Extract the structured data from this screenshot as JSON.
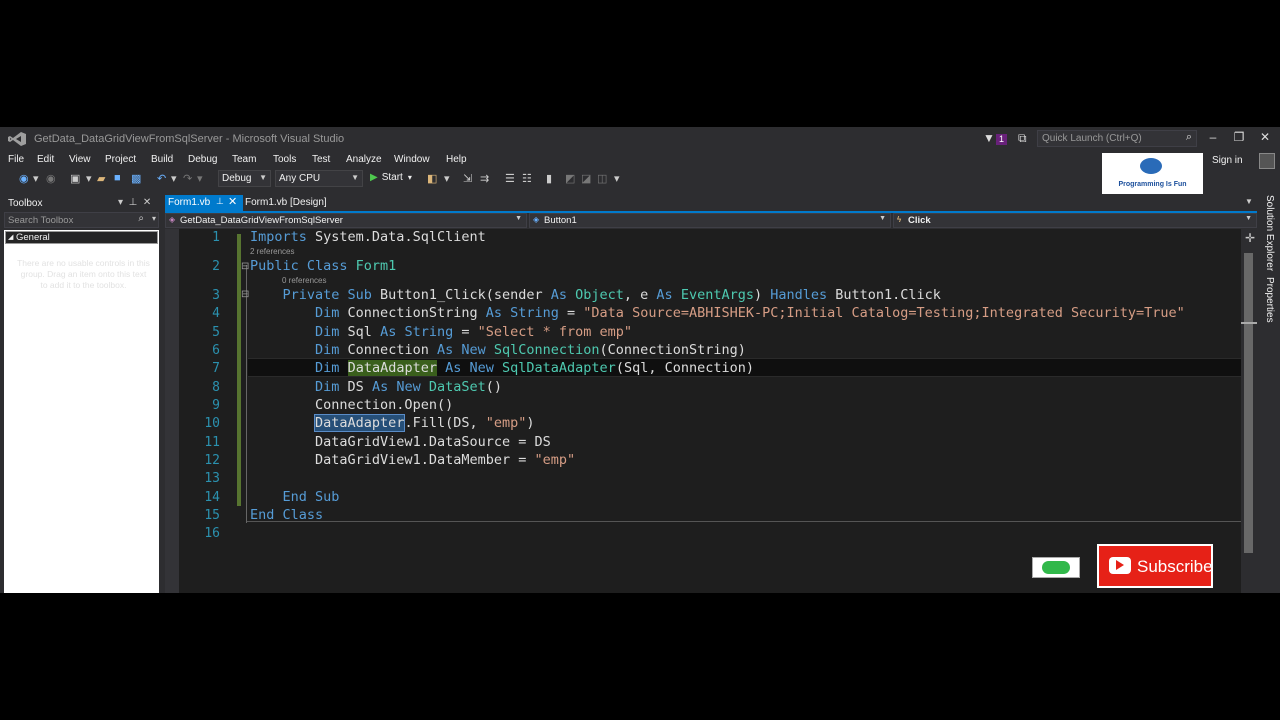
{
  "window": {
    "title": "GetData_DataGridViewFromSqlServer - Microsoft Visual Studio",
    "notification_count": "1",
    "quick_launch_placeholder": "Quick Launch (Ctrl+Q)",
    "sign_in": "Sign in"
  },
  "menu": [
    "File",
    "Edit",
    "View",
    "Project",
    "Build",
    "Debug",
    "Team",
    "Tools",
    "Test",
    "Analyze",
    "Window",
    "Help"
  ],
  "toolbar": {
    "config": "Debug",
    "platform": "Any CPU",
    "start": "Start"
  },
  "logo": {
    "text": "Programming Is Fun"
  },
  "toolbox": {
    "title": "Toolbox",
    "search_placeholder": "Search Toolbox",
    "group": "General",
    "empty_message": "There are no usable controls in this group. Drag an item onto this text to add it to the toolbox."
  },
  "tabs": {
    "active": "Form1.vb",
    "design": "Form1.vb [Design]"
  },
  "navbar": {
    "project": "GetData_DataGridViewFromSqlServer",
    "object": "Button1",
    "event": "Click"
  },
  "side_tabs": [
    "Solution Explorer",
    "Properties"
  ],
  "editor": {
    "references": [
      "2 references",
      "0 references"
    ],
    "line_numbers": [
      "1",
      "2",
      "3",
      "4",
      "5",
      "6",
      "7",
      "8",
      "9",
      "10",
      "11",
      "12",
      "13",
      "14",
      "15",
      "16"
    ],
    "code": {
      "l1": {
        "k": "Imports",
        "t": " System.Data.SqlClient"
      },
      "l2": {
        "k": "Public Class",
        "t": " Form1"
      },
      "l3": {
        "k1": "Private Sub",
        "t1": " Button1_Click(sender ",
        "k2": "As",
        "ty1": " Object",
        "t2": ", e ",
        "k3": "As",
        "ty2": " EventArgs",
        "t3": ") ",
        "k4": "Handles",
        "t4": " Button1.Click"
      },
      "l4": {
        "k1": "Dim",
        "t1": " ConnectionString ",
        "k2": "As",
        "k3": " String",
        "t2": " = ",
        "s": "\"Data Source=ABHISHEK-PC;Initial Catalog=Testing;Integrated Security=True\""
      },
      "l5": {
        "k1": "Dim",
        "t1": " Sql ",
        "k2": "As",
        "k3": " String",
        "t2": " = ",
        "s": "\"Select * from emp\""
      },
      "l6": {
        "k1": "Dim",
        "t1": " Connection ",
        "k2": "As New",
        "ty": " SqlConnection",
        "t2": "(ConnectionString)"
      },
      "l7": {
        "k1": "Dim",
        "hl": "DataAdapter",
        "k2": "As New",
        "ty": " SqlDataAdapter",
        "t2": "(Sql, Connection)"
      },
      "l8": {
        "k1": "Dim",
        "t1": " DS ",
        "k2": "As New",
        "ty": " DataSet",
        "t2": "()"
      },
      "l9": {
        "t": "Connection.Open()"
      },
      "l10": {
        "hl": "DataAdapter",
        "t1": ".Fill(DS, ",
        "s": "\"emp\"",
        "t2": ")"
      },
      "l11": {
        "t": "DataGridView1.DataSource = DS"
      },
      "l12": {
        "t1": "DataGridView1.DataMember = ",
        "s": "\"emp\""
      },
      "l14": {
        "k": "End Sub"
      },
      "l15": {
        "k": "End Class"
      }
    }
  },
  "overlay": {
    "subscribe": "Subscribe"
  }
}
